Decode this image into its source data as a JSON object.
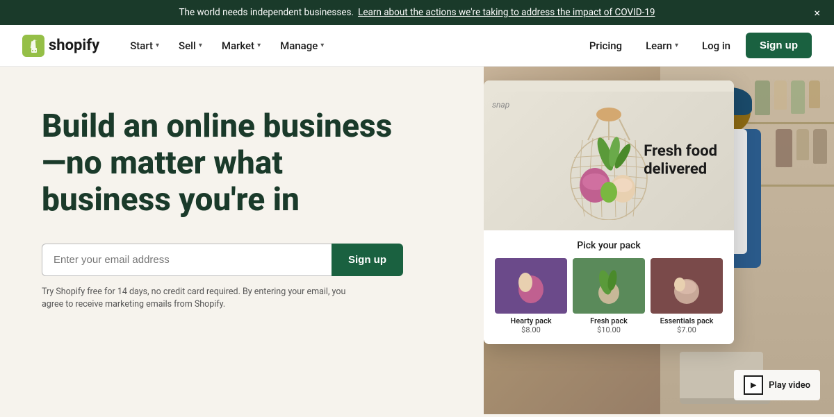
{
  "banner": {
    "text": "The world needs independent businesses.",
    "link_text": "Learn about the actions we're taking to address the impact of COVID-19",
    "close_label": "×"
  },
  "nav": {
    "logo_text": "shopify",
    "items_left": [
      {
        "label": "Start",
        "has_dropdown": true
      },
      {
        "label": "Sell",
        "has_dropdown": true
      },
      {
        "label": "Market",
        "has_dropdown": true
      },
      {
        "label": "Manage",
        "has_dropdown": true
      }
    ],
    "items_right": [
      {
        "label": "Pricing",
        "has_dropdown": false
      },
      {
        "label": "Learn",
        "has_dropdown": true
      },
      {
        "label": "Log in",
        "has_dropdown": false
      }
    ],
    "signup_label": "Sign up"
  },
  "hero": {
    "heading": "Build an online business —no matter what business you're in",
    "email_placeholder": "Enter your email address",
    "signup_label": "Sign up",
    "subtext": "Try Shopify free for 14 days, no credit card required. By entering your email, you agree to receive marketing emails from Shopify."
  },
  "food_card": {
    "snap_label": "snap",
    "hero_title_line1": "Fresh food",
    "hero_title_line2": "delivered",
    "pick_label": "Pick your pack",
    "packs": [
      {
        "name": "Hearty pack",
        "price": "$8.00",
        "bg": "#6b5b8a"
      },
      {
        "name": "Fresh pack",
        "price": "$10.00",
        "bg": "#5a8a5a"
      },
      {
        "name": "Essentials pack",
        "price": "$7.00",
        "bg": "#8a5a5a"
      }
    ]
  },
  "play_video": {
    "label": "Play video"
  },
  "colors": {
    "dark_green": "#1a6140",
    "deep_green": "#1a3a2a",
    "banner_bg": "#1a3a2a",
    "bg": "#f6f3ed"
  }
}
